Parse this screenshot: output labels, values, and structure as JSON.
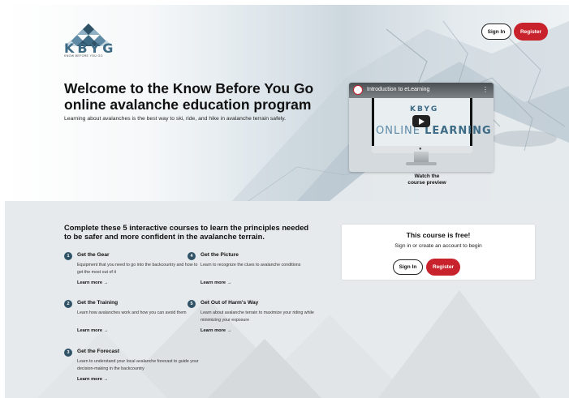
{
  "brand": {
    "logo_text": "KBYG",
    "logo_subtext": "KNOW BEFORE YOU GO",
    "accent": "#c8232c",
    "dark": "#2f5266"
  },
  "header": {
    "signin_label": "Sign In",
    "register_label": "Register"
  },
  "hero": {
    "title": "Welcome to the Know Before You Go online avalanche education program",
    "subtitle": "Learning about avalanches is the best way to ski, ride, and hike in avalanche terrain safely.",
    "video": {
      "title": "Introduction to eLearning",
      "screen_logo": "KBYG",
      "screen_text_1": "ONLINE",
      "screen_text_2": "LEARNING",
      "caption_line1": "Watch the",
      "caption_line2": "course preview",
      "menu_icon": "more-vert-icon",
      "play_icon": "play-icon"
    }
  },
  "courses": {
    "heading": "Complete these 5 interactive courses to learn the principles needed to be safer and more confident in the avalanche terrain.",
    "learn_more": "Learn more",
    "items": [
      {
        "num": "1",
        "title": "Get the Gear",
        "desc": "Equipment that you need to go into the backcountry and how to get the most out of it"
      },
      {
        "num": "2",
        "title": "Get the Training",
        "desc": "Learn how avalanches work and how you can avoid them"
      },
      {
        "num": "3",
        "title": "Get the Forecast",
        "desc": "Learn to understand your local avalanche forecast to guide your decision-making in the backcountry"
      },
      {
        "num": "4",
        "title": "Get the Picture",
        "desc": "Learn to recognize the clues to avalanche conditions"
      },
      {
        "num": "5",
        "title": "Get Out of Harm's Way",
        "desc": "Learn about avalanche terrain to maximize your riding while minimizing your exposure"
      }
    ]
  },
  "signup_card": {
    "title": "This course is free!",
    "subtitle": "Sign in or create an account to begin",
    "signin_label": "Sign In",
    "register_label": "Register"
  }
}
